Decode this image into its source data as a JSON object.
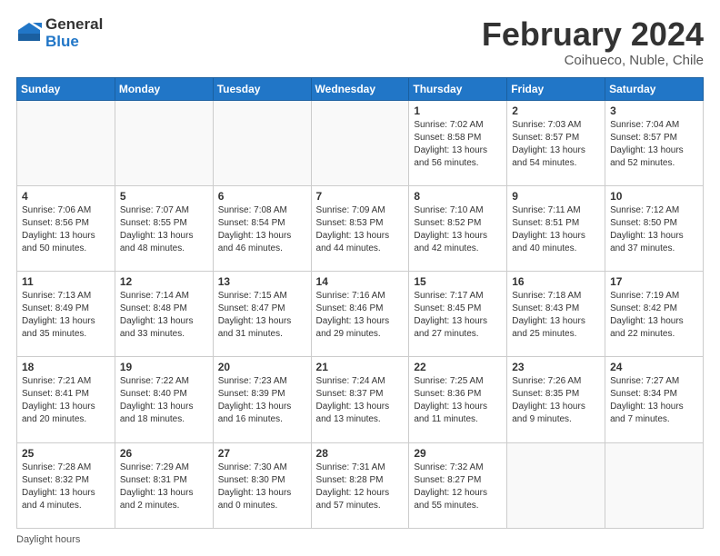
{
  "logo": {
    "general": "General",
    "blue": "Blue"
  },
  "title": {
    "month_year": "February 2024",
    "location": "Coihueco, Nuble, Chile"
  },
  "days_of_week": [
    "Sunday",
    "Monday",
    "Tuesday",
    "Wednesday",
    "Thursday",
    "Friday",
    "Saturday"
  ],
  "footer": {
    "label": "Daylight hours"
  },
  "weeks": [
    [
      {
        "day": "",
        "sunrise": "",
        "sunset": "",
        "daylight": ""
      },
      {
        "day": "",
        "sunrise": "",
        "sunset": "",
        "daylight": ""
      },
      {
        "day": "",
        "sunrise": "",
        "sunset": "",
        "daylight": ""
      },
      {
        "day": "",
        "sunrise": "",
        "sunset": "",
        "daylight": ""
      },
      {
        "day": "1",
        "sunrise": "7:02 AM",
        "sunset": "8:58 PM",
        "daylight": "13 hours and 56 minutes."
      },
      {
        "day": "2",
        "sunrise": "7:03 AM",
        "sunset": "8:57 PM",
        "daylight": "13 hours and 54 minutes."
      },
      {
        "day": "3",
        "sunrise": "7:04 AM",
        "sunset": "8:57 PM",
        "daylight": "13 hours and 52 minutes."
      }
    ],
    [
      {
        "day": "4",
        "sunrise": "7:06 AM",
        "sunset": "8:56 PM",
        "daylight": "13 hours and 50 minutes."
      },
      {
        "day": "5",
        "sunrise": "7:07 AM",
        "sunset": "8:55 PM",
        "daylight": "13 hours and 48 minutes."
      },
      {
        "day": "6",
        "sunrise": "7:08 AM",
        "sunset": "8:54 PM",
        "daylight": "13 hours and 46 minutes."
      },
      {
        "day": "7",
        "sunrise": "7:09 AM",
        "sunset": "8:53 PM",
        "daylight": "13 hours and 44 minutes."
      },
      {
        "day": "8",
        "sunrise": "7:10 AM",
        "sunset": "8:52 PM",
        "daylight": "13 hours and 42 minutes."
      },
      {
        "day": "9",
        "sunrise": "7:11 AM",
        "sunset": "8:51 PM",
        "daylight": "13 hours and 40 minutes."
      },
      {
        "day": "10",
        "sunrise": "7:12 AM",
        "sunset": "8:50 PM",
        "daylight": "13 hours and 37 minutes."
      }
    ],
    [
      {
        "day": "11",
        "sunrise": "7:13 AM",
        "sunset": "8:49 PM",
        "daylight": "13 hours and 35 minutes."
      },
      {
        "day": "12",
        "sunrise": "7:14 AM",
        "sunset": "8:48 PM",
        "daylight": "13 hours and 33 minutes."
      },
      {
        "day": "13",
        "sunrise": "7:15 AM",
        "sunset": "8:47 PM",
        "daylight": "13 hours and 31 minutes."
      },
      {
        "day": "14",
        "sunrise": "7:16 AM",
        "sunset": "8:46 PM",
        "daylight": "13 hours and 29 minutes."
      },
      {
        "day": "15",
        "sunrise": "7:17 AM",
        "sunset": "8:45 PM",
        "daylight": "13 hours and 27 minutes."
      },
      {
        "day": "16",
        "sunrise": "7:18 AM",
        "sunset": "8:43 PM",
        "daylight": "13 hours and 25 minutes."
      },
      {
        "day": "17",
        "sunrise": "7:19 AM",
        "sunset": "8:42 PM",
        "daylight": "13 hours and 22 minutes."
      }
    ],
    [
      {
        "day": "18",
        "sunrise": "7:21 AM",
        "sunset": "8:41 PM",
        "daylight": "13 hours and 20 minutes."
      },
      {
        "day": "19",
        "sunrise": "7:22 AM",
        "sunset": "8:40 PM",
        "daylight": "13 hours and 18 minutes."
      },
      {
        "day": "20",
        "sunrise": "7:23 AM",
        "sunset": "8:39 PM",
        "daylight": "13 hours and 16 minutes."
      },
      {
        "day": "21",
        "sunrise": "7:24 AM",
        "sunset": "8:37 PM",
        "daylight": "13 hours and 13 minutes."
      },
      {
        "day": "22",
        "sunrise": "7:25 AM",
        "sunset": "8:36 PM",
        "daylight": "13 hours and 11 minutes."
      },
      {
        "day": "23",
        "sunrise": "7:26 AM",
        "sunset": "8:35 PM",
        "daylight": "13 hours and 9 minutes."
      },
      {
        "day": "24",
        "sunrise": "7:27 AM",
        "sunset": "8:34 PM",
        "daylight": "13 hours and 7 minutes."
      }
    ],
    [
      {
        "day": "25",
        "sunrise": "7:28 AM",
        "sunset": "8:32 PM",
        "daylight": "13 hours and 4 minutes."
      },
      {
        "day": "26",
        "sunrise": "7:29 AM",
        "sunset": "8:31 PM",
        "daylight": "13 hours and 2 minutes."
      },
      {
        "day": "27",
        "sunrise": "7:30 AM",
        "sunset": "8:30 PM",
        "daylight": "13 hours and 0 minutes."
      },
      {
        "day": "28",
        "sunrise": "7:31 AM",
        "sunset": "8:28 PM",
        "daylight": "12 hours and 57 minutes."
      },
      {
        "day": "29",
        "sunrise": "7:32 AM",
        "sunset": "8:27 PM",
        "daylight": "12 hours and 55 minutes."
      },
      {
        "day": "",
        "sunrise": "",
        "sunset": "",
        "daylight": ""
      },
      {
        "day": "",
        "sunrise": "",
        "sunset": "",
        "daylight": ""
      }
    ]
  ]
}
